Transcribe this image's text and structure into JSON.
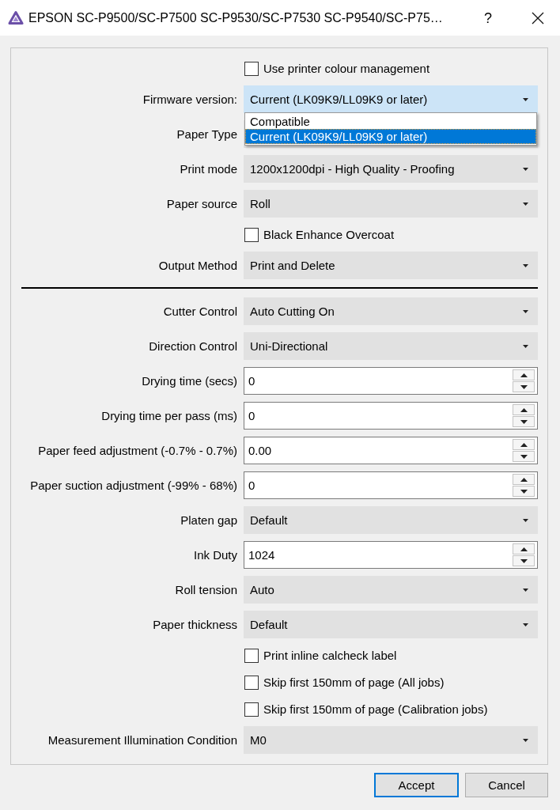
{
  "window": {
    "title": "EPSON SC-P9500/SC-P7500 SC-P9530/SC-P7530 SC-P9540/SC-P75…",
    "help_button": "?"
  },
  "settings": [
    {
      "kind": "checkbox",
      "label": "Use printer colour management",
      "checked": false
    },
    {
      "kind": "combo",
      "label": "Firmware version:",
      "value": "Current (LK09K9/LL09K9 or later)",
      "open": true,
      "options": [
        {
          "label": "Compatible",
          "selected": false
        },
        {
          "label": "Current (LK09K9/LL09K9 or later)",
          "selected": true
        }
      ]
    },
    {
      "kind": "combo",
      "label": "Paper Type",
      "open": false
    },
    {
      "kind": "combo",
      "label": "Print mode",
      "value": "1200x1200dpi - High Quality - Proofing",
      "open": false
    },
    {
      "kind": "combo",
      "label": "Paper source",
      "value": "Roll",
      "open": false
    },
    {
      "kind": "checkbox",
      "label": "Black Enhance Overcoat",
      "checked": false
    },
    {
      "kind": "combo",
      "label": "Output Method",
      "value": "Print and Delete",
      "open": false
    },
    {
      "kind": "divider"
    },
    {
      "kind": "combo",
      "label": "Cutter Control",
      "value": "Auto Cutting On",
      "open": false
    },
    {
      "kind": "combo",
      "label": "Direction Control",
      "value": "Uni-Directional",
      "open": false
    },
    {
      "kind": "spin",
      "label": "Drying time (secs)",
      "value": "0"
    },
    {
      "kind": "spin",
      "label": "Drying time per pass (ms)",
      "value": "0"
    },
    {
      "kind": "spin",
      "label": "Paper feed adjustment (-0.7% - 0.7%)",
      "value": "0.00"
    },
    {
      "kind": "spin",
      "label": "Paper suction adjustment (-99% - 68%)",
      "value": "0"
    },
    {
      "kind": "combo",
      "label": "Platen gap",
      "value": "Default",
      "open": false
    },
    {
      "kind": "spin",
      "label": "Ink Duty",
      "value": "1024"
    },
    {
      "kind": "combo",
      "label": "Roll tension",
      "value": "Auto",
      "open": false
    },
    {
      "kind": "combo",
      "label": "Paper thickness",
      "value": "Default",
      "open": false
    },
    {
      "kind": "checkbox",
      "label": "Print inline calcheck label",
      "checked": false
    },
    {
      "kind": "checkbox",
      "label": "Skip first 150mm of page (All jobs)",
      "checked": false
    },
    {
      "kind": "checkbox",
      "label": "Skip first 150mm of page (Calibration jobs)",
      "checked": false
    },
    {
      "kind": "combo",
      "label": "Measurement Illumination Condition",
      "value": "M0",
      "open": false
    }
  ],
  "buttons": [
    {
      "label": "Accept",
      "focused": true
    },
    {
      "label": "Cancel",
      "focused": false
    }
  ]
}
